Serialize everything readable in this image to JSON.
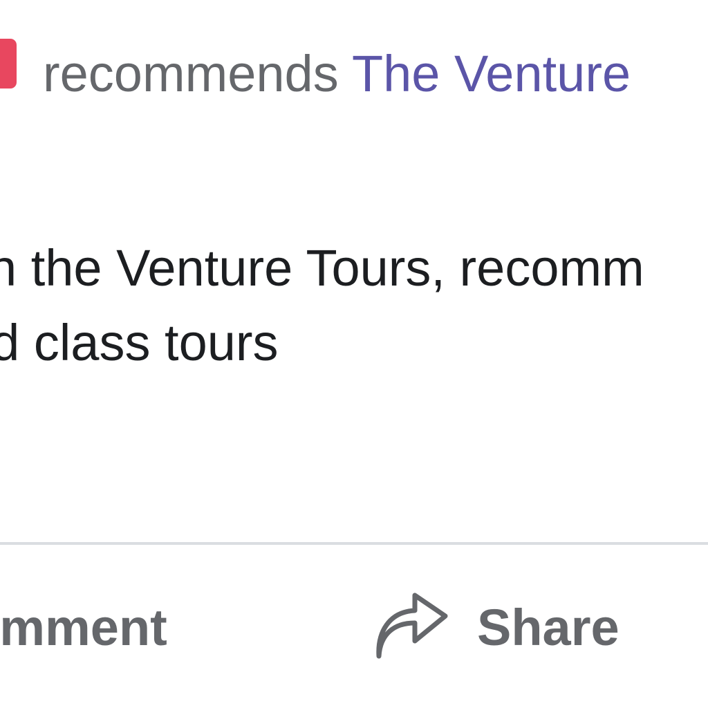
{
  "post": {
    "header": {
      "verb": "recommends",
      "page_name": "The Venture"
    },
    "body_lines": [
      "ith the Venture Tours, recomm",
      "nd class tours"
    ]
  },
  "actions": {
    "comment_label": "omment",
    "share_label": "Share",
    "share_icon": "share-arrow-icon"
  },
  "colors": {
    "recommend_icon": "#e8475f",
    "link": "#5b55a8",
    "secondary_text": "#65676b",
    "body_text": "#1c1e21",
    "divider": "#dadde1"
  }
}
